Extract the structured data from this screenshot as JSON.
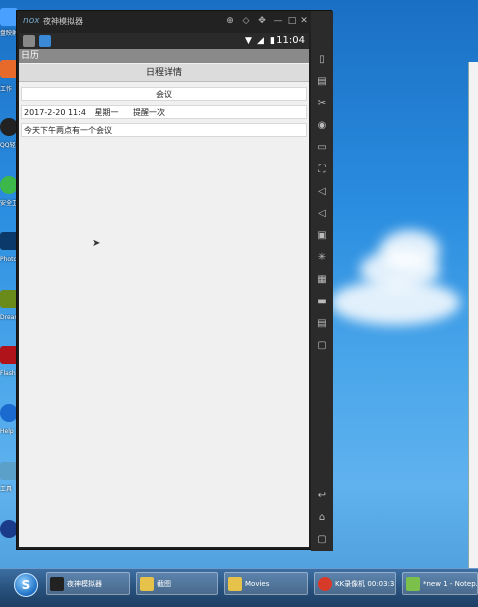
{
  "emulator": {
    "logo": "nox",
    "title": "夜神模拟器",
    "controls": [
      "⊕",
      "◇",
      "✥",
      "—",
      "□",
      "✕"
    ],
    "time": "11:04"
  },
  "app": {
    "title": "日历",
    "header": "日程详情",
    "event_title": "会议",
    "event_date": "2017-2-20 11:4",
    "event_weekday": "星期一",
    "event_reminder": "提醒一次",
    "event_description": "今天下午两点有一个会议"
  },
  "desktop": {
    "icon_labels": [
      "盘映射",
      "工作",
      "QQ轻聊版",
      "安全卫士",
      "Photoshop",
      "Dreamweaver",
      "Flash",
      "Help",
      "工具"
    ],
    "watermark": "装机"
  },
  "taskbar": {
    "items": [
      "夜神模拟器",
      "截图",
      "Movies",
      "KK录像机 00:03:35",
      "*new 1 - Notep..."
    ]
  },
  "colors": {
    "desktop_bg": "#2b8ee0",
    "app_bar": "#8a8a8a",
    "header_bg": "#dcdcdc",
    "taskbar": "#28527e"
  }
}
